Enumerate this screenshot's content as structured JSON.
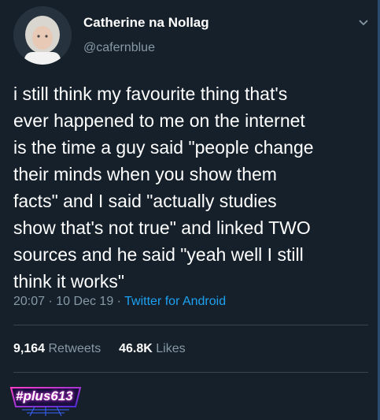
{
  "tweet": {
    "display_name": "Catherine na Nollag",
    "handle": "@cafernblue",
    "lines": [
      "i still think my favourite thing that's",
      "ever happened to me on the internet",
      "is the time a guy said \"people change",
      "their minds when you show them",
      "facts\" and I said \"actually studies",
      "show that's not true\" and linked TWO",
      "sources and he said \"yeah well I still",
      "think it works\""
    ],
    "time": "20:07",
    "date": "10 Dec 19",
    "source": "Twitter for Android",
    "retweets_count": "9,164",
    "retweets_label": "Retweets",
    "likes_count": "46.8K",
    "likes_label": "Likes"
  },
  "watermark": {
    "text": "#plus613"
  },
  "icons": {
    "menu": "chevron-down-icon",
    "avatar": "avatar"
  },
  "colors": {
    "background": "#15202b",
    "text": "#ffffff",
    "muted": "#8899a6",
    "link": "#1da1f2",
    "divider": "#38444d"
  }
}
